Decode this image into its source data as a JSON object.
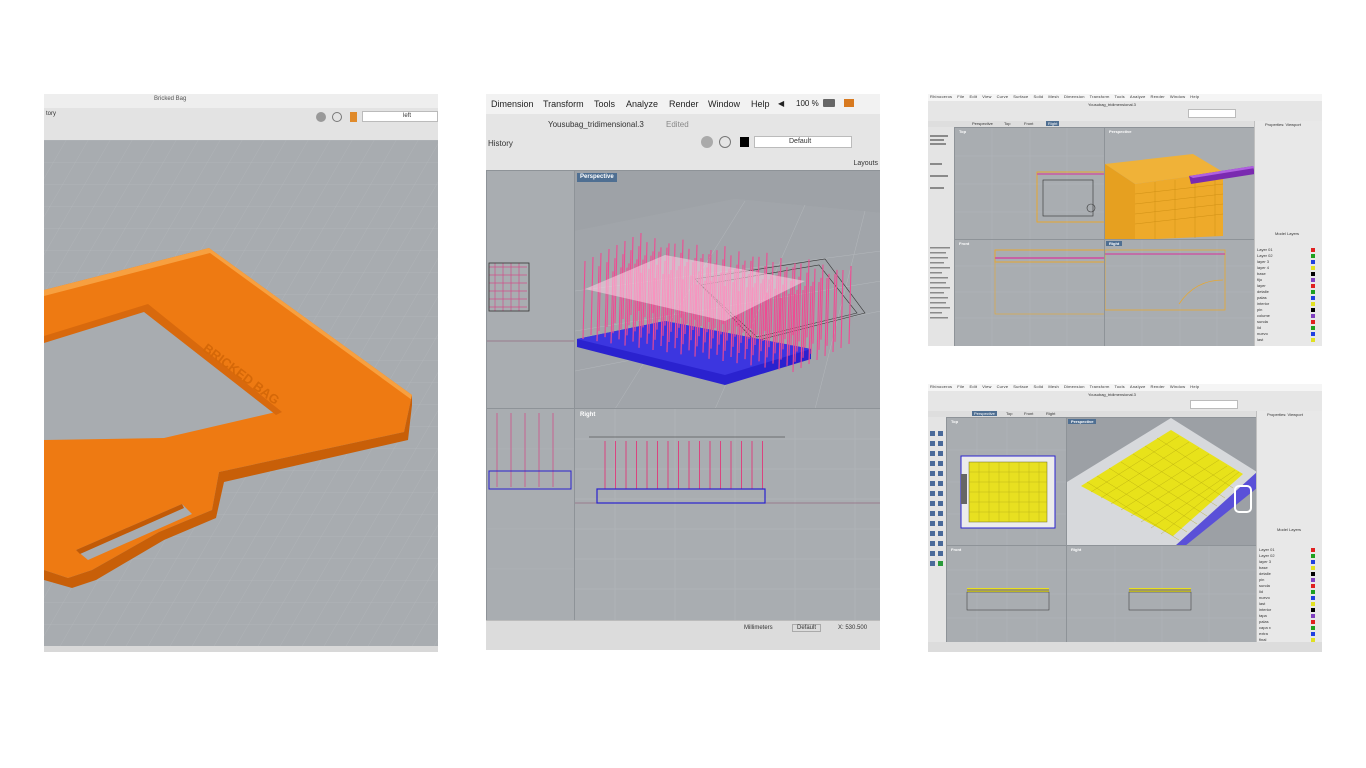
{
  "panel1": {
    "title": "Bricked Bag",
    "toolbar_left": "tory",
    "status_right": "left",
    "part_engraving": "BRICKED BAG"
  },
  "panel2": {
    "menu": [
      "Dimension",
      "Transform",
      "Tools",
      "Analyze",
      "Render",
      "Window",
      "Help"
    ],
    "battery": "100 %",
    "doc_title": "Yousubag_tridimensional.3",
    "doc_state": "Edited",
    "history_label": "History",
    "layer_current": "Default",
    "layouts_label": "Layouts",
    "viewport_perspective": "Perspective",
    "viewport_right": "Right",
    "status_units": "Millimeters",
    "status_layer": "Default",
    "status_coords": "X: 530.500"
  },
  "panel3": {
    "app_menu": [
      "Rhinoceros",
      "File",
      "Edit",
      "View",
      "Curve",
      "Surface",
      "Solid",
      "Mesh",
      "Dimension",
      "Transform",
      "Tools",
      "Analyze",
      "Render",
      "Window",
      "Help"
    ],
    "doc_title": "Yousubag_tridimensional.3",
    "tabs": [
      "Perspective",
      "Top",
      "Front",
      "Right"
    ],
    "viewports": [
      "Top",
      "Perspective",
      "Front",
      "Right"
    ],
    "props_title": "Properties: Viewport",
    "layers_title": "Model Layers",
    "layers": [
      "Layer 01",
      "Layer 02",
      "layer 3",
      "layer 4",
      "base",
      "fijo",
      "layer",
      "detalle",
      "palas",
      "interior",
      "pin",
      "colume",
      "sunda",
      "lid",
      "nuevo",
      "last"
    ]
  },
  "panel4": {
    "app_menu": [
      "Rhinoceros",
      "File",
      "Edit",
      "View",
      "Curve",
      "Surface",
      "Solid",
      "Mesh",
      "Dimension",
      "Transform",
      "Tools",
      "Analyze",
      "Render",
      "Window",
      "Help"
    ],
    "doc_title": "Yousubag_tridimensional.3",
    "tabs": [
      "Perspective",
      "Top",
      "Front",
      "Right"
    ],
    "viewports": [
      "Top",
      "Perspective",
      "Front",
      "Right"
    ],
    "props_title": "Properties: Viewport",
    "layers_title": "Model Layers",
    "layers": [
      "Layer 01",
      "Layer 02",
      "layer 3",
      "base",
      "detalle",
      "pin",
      "sunda",
      "lid",
      "nuevo",
      "last",
      "interior",
      "tapa",
      "palas",
      "capa x",
      "extra",
      "final"
    ]
  },
  "colors": {
    "orange": "#f07a10",
    "viewport_bg": "#a6abb0",
    "pink": "#e0387a",
    "blue": "#2520c8",
    "yellow": "#f0e21a",
    "gold": "#e8a830"
  }
}
